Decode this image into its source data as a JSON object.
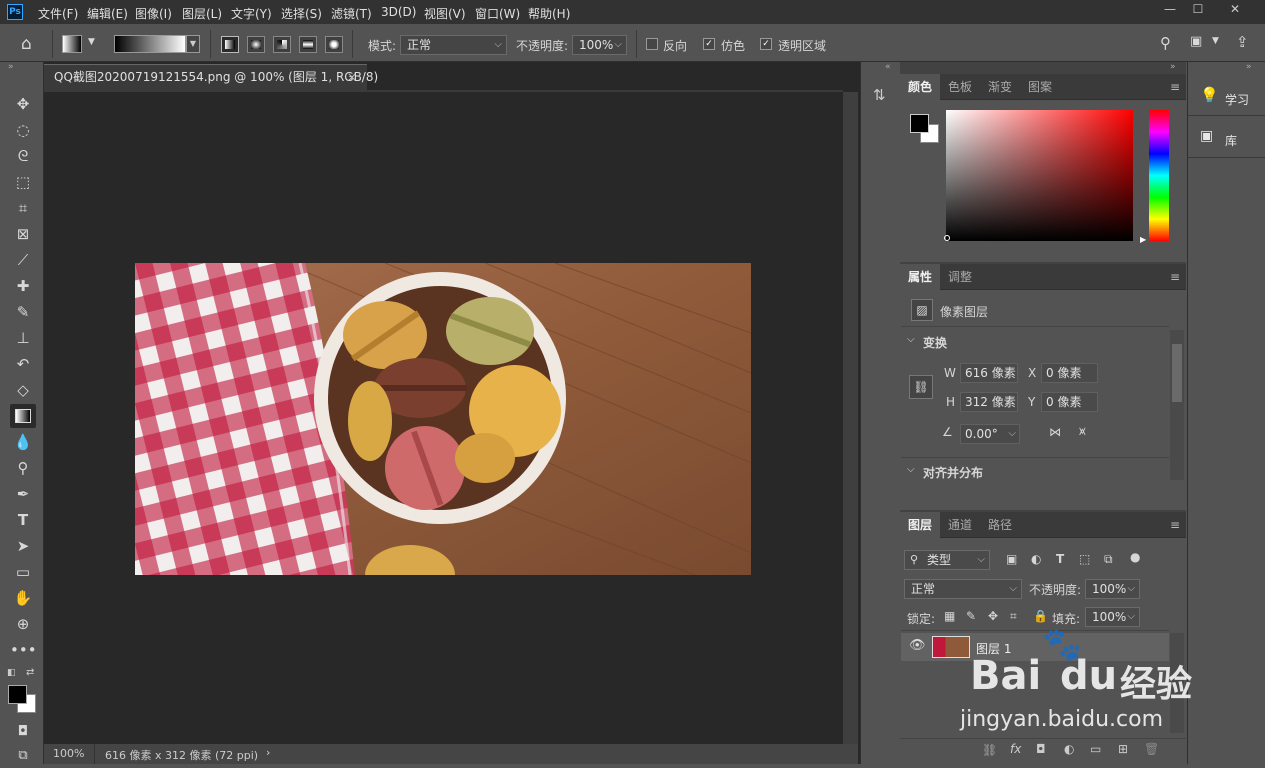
{
  "app": {
    "logo": "Ps"
  },
  "menubar": {
    "items": [
      "文件(F)",
      "编辑(E)",
      "图像(I)",
      "图层(L)",
      "文字(Y)",
      "选择(S)",
      "滤镜(T)",
      "3D(D)",
      "视图(V)",
      "窗口(W)",
      "帮助(H)"
    ],
    "minimize": "—",
    "maximize": "☐",
    "close": "✕"
  },
  "options": {
    "mode_label": "模式:",
    "mode_value": "正常",
    "opacity_label": "不透明度:",
    "opacity_value": "100%",
    "reverse_label": "反向",
    "dither_label": "仿色",
    "transparency_label": "透明区域",
    "reverse_checked": false,
    "dither_checked": true,
    "transparency_checked": true
  },
  "document": {
    "tab_title": "QQ截图20200719121554.png @ 100% (图层 1, RGB/8)",
    "tab_close": "×",
    "zoom": "100%",
    "size_info": "616 像素 x 312 像素 (72 ppi)"
  },
  "color_panel": {
    "tabs": [
      "颜色",
      "色板",
      "渐变",
      "图案"
    ],
    "foreground": "#000000",
    "background": "#ffffff",
    "hue_color": "#ff0000"
  },
  "properties_panel": {
    "tabs": [
      "属性",
      "调整"
    ],
    "layer_type": "像素图层",
    "transform_title": "变换",
    "w_label": "W",
    "w_value": "616 像素",
    "h_label": "H",
    "h_value": "312 像素",
    "x_label": "X",
    "x_value": "0 像素",
    "y_label": "Y",
    "y_value": "0 像素",
    "angle_value": "0.00°",
    "align_title": "对齐并分布"
  },
  "layers_panel": {
    "tabs": [
      "图层",
      "通道",
      "路径"
    ],
    "filter_value": "类型",
    "blend_value": "正常",
    "opacity_label": "不透明度:",
    "opacity_value": "100%",
    "lock_label": "锁定:",
    "fill_label": "填充:",
    "fill_value": "100%",
    "layers": [
      {
        "name": "图层 1",
        "visible": true
      }
    ]
  },
  "far_panel": {
    "learn": "学习",
    "library": "库"
  },
  "watermark": {
    "brand": "Bai",
    "brand2": "du",
    "cn": "经验",
    "url": "jingyan.baidu.com"
  }
}
